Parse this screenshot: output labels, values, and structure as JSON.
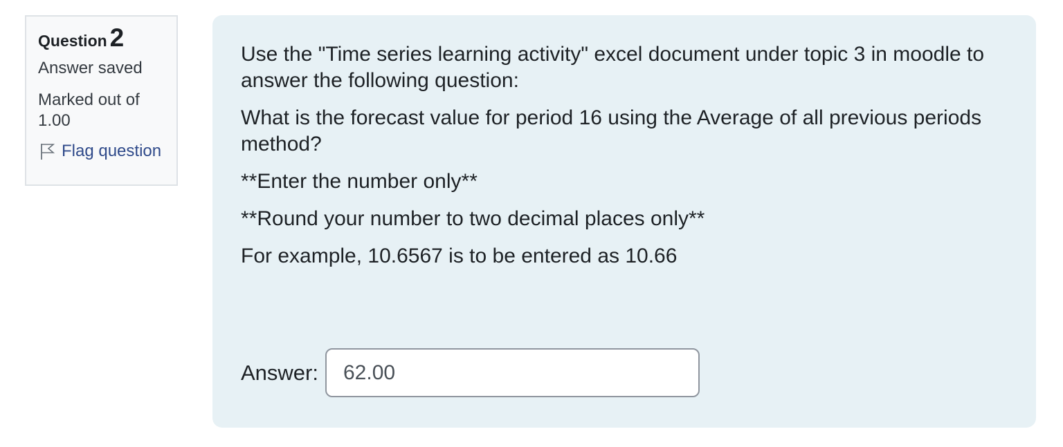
{
  "info": {
    "question_word": "Question",
    "question_number": "2",
    "state": "Answer saved",
    "grade": "Marked out of 1.00",
    "flag_label": "Flag question",
    "flag_icon": "flag-outline-icon"
  },
  "question": {
    "paragraphs": [
      "Use the \"Time series learning activity\" excel document under topic 3 in moodle to answer the following question:",
      "What is the forecast value for period 16 using the Average of all previous periods method?",
      "**Enter the number only**",
      "**Round your number to two decimal places only**",
      "For example, 10.6567 is to be entered as 10.66"
    ]
  },
  "answer": {
    "label": "Answer:",
    "value": "62.00"
  },
  "colors": {
    "info_bg": "#f8f9fa",
    "info_border": "#dee2e6",
    "content_bg": "#e7f1f5",
    "link": "#2f4a8a",
    "text": "#1d2125"
  }
}
